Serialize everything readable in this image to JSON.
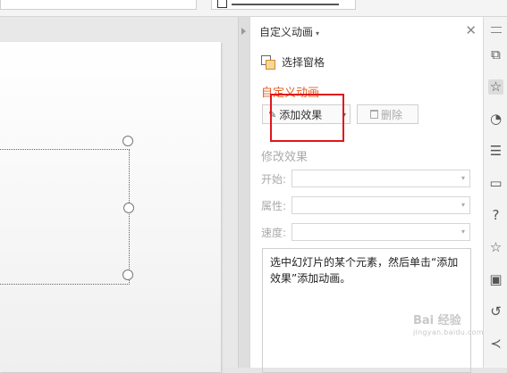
{
  "task_pane": {
    "title": "自定义动画",
    "selection_pane_label": "选择窗格",
    "section_custom_animation": "自定义动画",
    "add_effect_label": "添加效果",
    "delete_label": "删除",
    "modify_effect_title": "修改效果",
    "start_label": "开始:",
    "property_label": "属性:",
    "speed_label": "速度:",
    "hint_text": "选中幻灯片的某个元素，然后单击“添加效果”添加动画。"
  },
  "colors": {
    "accent_orange": "#e5591f",
    "highlight_red": "#e0161b"
  },
  "icons": {
    "close": "close-icon",
    "selection_pane": "selection-pane-icon",
    "pen": "pen-icon",
    "trash": "trash-icon",
    "side_tools": [
      "layers-icon",
      "star-animation-icon",
      "shapes-icon",
      "settings-sliders-icon",
      "archive-icon",
      "help-icon",
      "star-icon",
      "image-icon",
      "history-icon",
      "share-icon"
    ]
  },
  "watermark": {
    "brand": "Bai 经验",
    "url": "jingyan.baidu.com"
  }
}
